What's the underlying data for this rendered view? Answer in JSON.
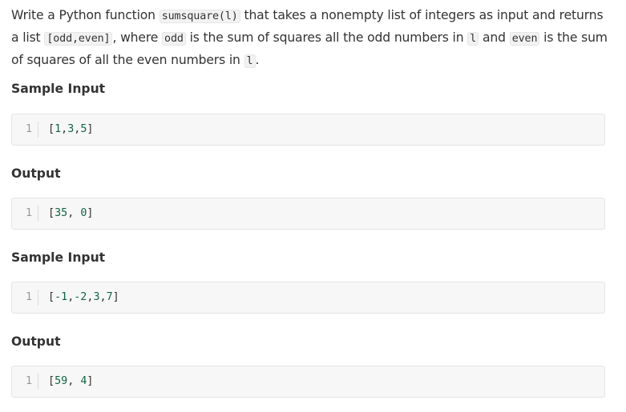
{
  "problem": {
    "parts": [
      {
        "type": "text",
        "value": "Write a Python function "
      },
      {
        "type": "code",
        "value": "sumsquare(l)"
      },
      {
        "type": "text",
        "value": " that takes a nonempty list of integers as input and returns a list "
      },
      {
        "type": "code",
        "value": "[odd,even]"
      },
      {
        "type": "text",
        "value": ", where "
      },
      {
        "type": "code",
        "value": "odd"
      },
      {
        "type": "text",
        "value": " is the sum of squares all the odd numbers in "
      },
      {
        "type": "code",
        "value": "l"
      },
      {
        "type": "text",
        "value": " and "
      },
      {
        "type": "code",
        "value": "even"
      },
      {
        "type": "text",
        "value": " is the sum of squares of all the even numbers in "
      },
      {
        "type": "code",
        "value": "l"
      },
      {
        "type": "text",
        "value": "."
      }
    ]
  },
  "examples": [
    {
      "input_heading": "Sample Input",
      "input_line_no": "1",
      "input_code": "[1,3,5]",
      "output_heading": "Output",
      "output_line_no": "1",
      "output_code": "[35, 0]"
    },
    {
      "input_heading": "Sample Input",
      "input_line_no": "1",
      "input_code": "[-1,-2,3,7]",
      "output_heading": "Output",
      "output_line_no": "1",
      "output_code": "[59, 4]"
    }
  ]
}
